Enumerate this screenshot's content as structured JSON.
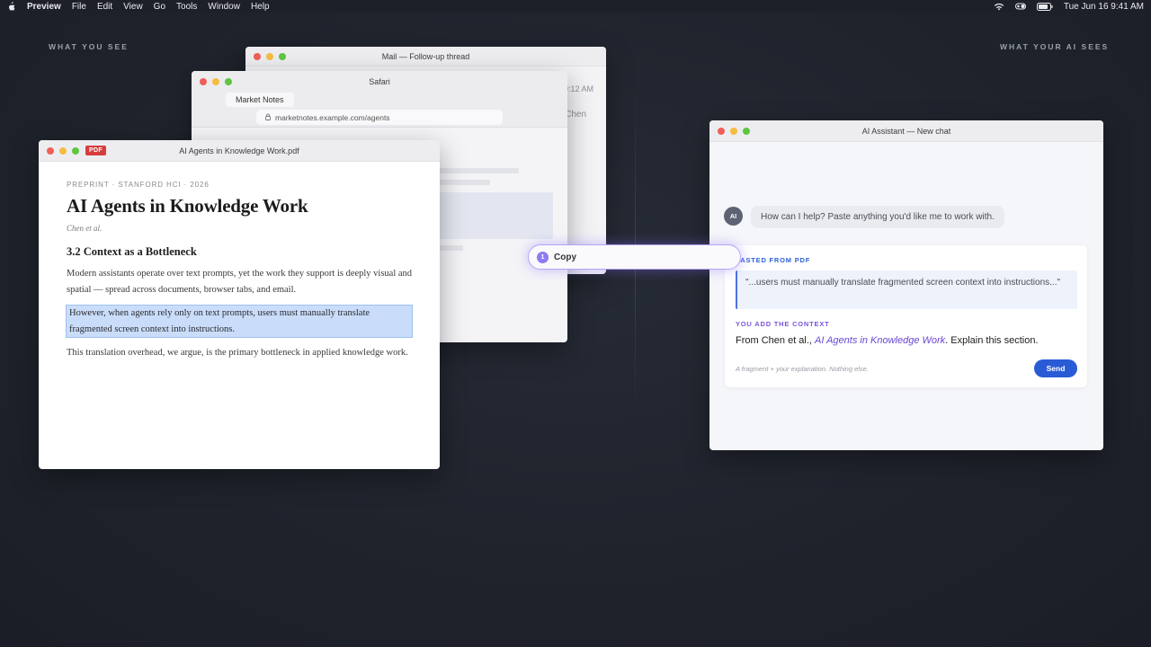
{
  "menubar": {
    "app": "Preview",
    "items": [
      "File",
      "Edit",
      "View",
      "Go",
      "Tools",
      "Window",
      "Help"
    ],
    "clock": "Tue Jun 16  9:41 AM"
  },
  "captions": {
    "left": "WHAT YOU SEE",
    "right": "WHAT YOUR AI SEES"
  },
  "mail": {
    "title": "Mail — Follow-up thread",
    "time": "9:12 AM",
    "from": "Chen"
  },
  "safari": {
    "title": "Safari",
    "tab": "Market Notes",
    "url": "marketnotes.example.com/agents"
  },
  "pdf": {
    "badge": "PDF",
    "title": "AI Agents in Knowledge Work.pdf",
    "kicker": "PREPRINT · STANFORD HCI · 2026",
    "heading": "AI Agents in Knowledge Work",
    "authors": "Chen et al.",
    "section": "3.2  Context as a Bottleneck",
    "para1": "Modern assistants operate over text prompts, yet the work they support is deeply visual and spatial — spread across documents, browser tabs, and email.",
    "highlight": "However, when agents rely only on text prompts, users must manually translate fragmented screen context into instructions.",
    "para2": "This translation overhead, we argue, is the primary bottleneck in applied knowledge work."
  },
  "copy": {
    "step": "1",
    "label": "Copy"
  },
  "ai": {
    "title": "AI Assistant — New chat",
    "avatar": "AI",
    "greeting": "How can I help? Paste anything you'd like me to work with.",
    "pasted_label": "PASTED FROM PDF",
    "quote": "\"...users must manually translate fragmented screen context into instructions...\"",
    "context_label": "YOU ADD THE CONTEXT",
    "context_pre": "From Chen et al., ",
    "context_em": "AI Agents in Knowledge Work",
    "context_post": ". Explain this section.",
    "hint": "A fragment + your explanation. Nothing else.",
    "send": "Send"
  }
}
